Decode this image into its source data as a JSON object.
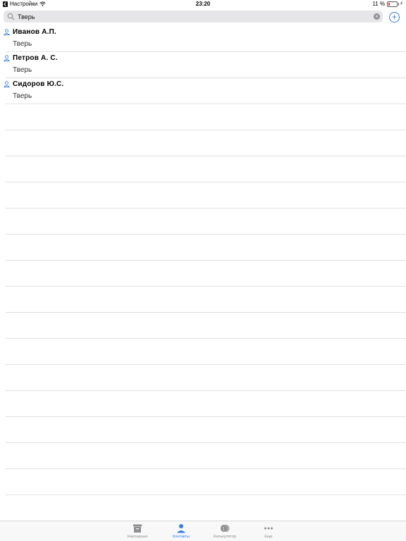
{
  "status_bar": {
    "back_label": "Настройки",
    "time": "23:20",
    "battery_text": "11 %"
  },
  "search": {
    "value": "Тверь",
    "clear_icon": "×"
  },
  "add_icon": "+",
  "contacts": [
    {
      "name": "Иванов А.П.",
      "city": "Тверь"
    },
    {
      "name": "Петров А. С.",
      "city": "Тверь"
    },
    {
      "name": "Сидоров Ю.С.",
      "city": "Тверь"
    }
  ],
  "tabs": [
    {
      "label": "Накладные",
      "icon": "archive-box-icon"
    },
    {
      "label": "Контакты",
      "icon": "person-icon"
    },
    {
      "label": "Калькулятор",
      "icon": "coins-icon"
    },
    {
      "label": "Еще",
      "icon": "more-dots-icon"
    }
  ],
  "colors": {
    "accent": "#2f7cf6",
    "inactive": "#8e8e93",
    "battery_low": "#ee3333"
  }
}
